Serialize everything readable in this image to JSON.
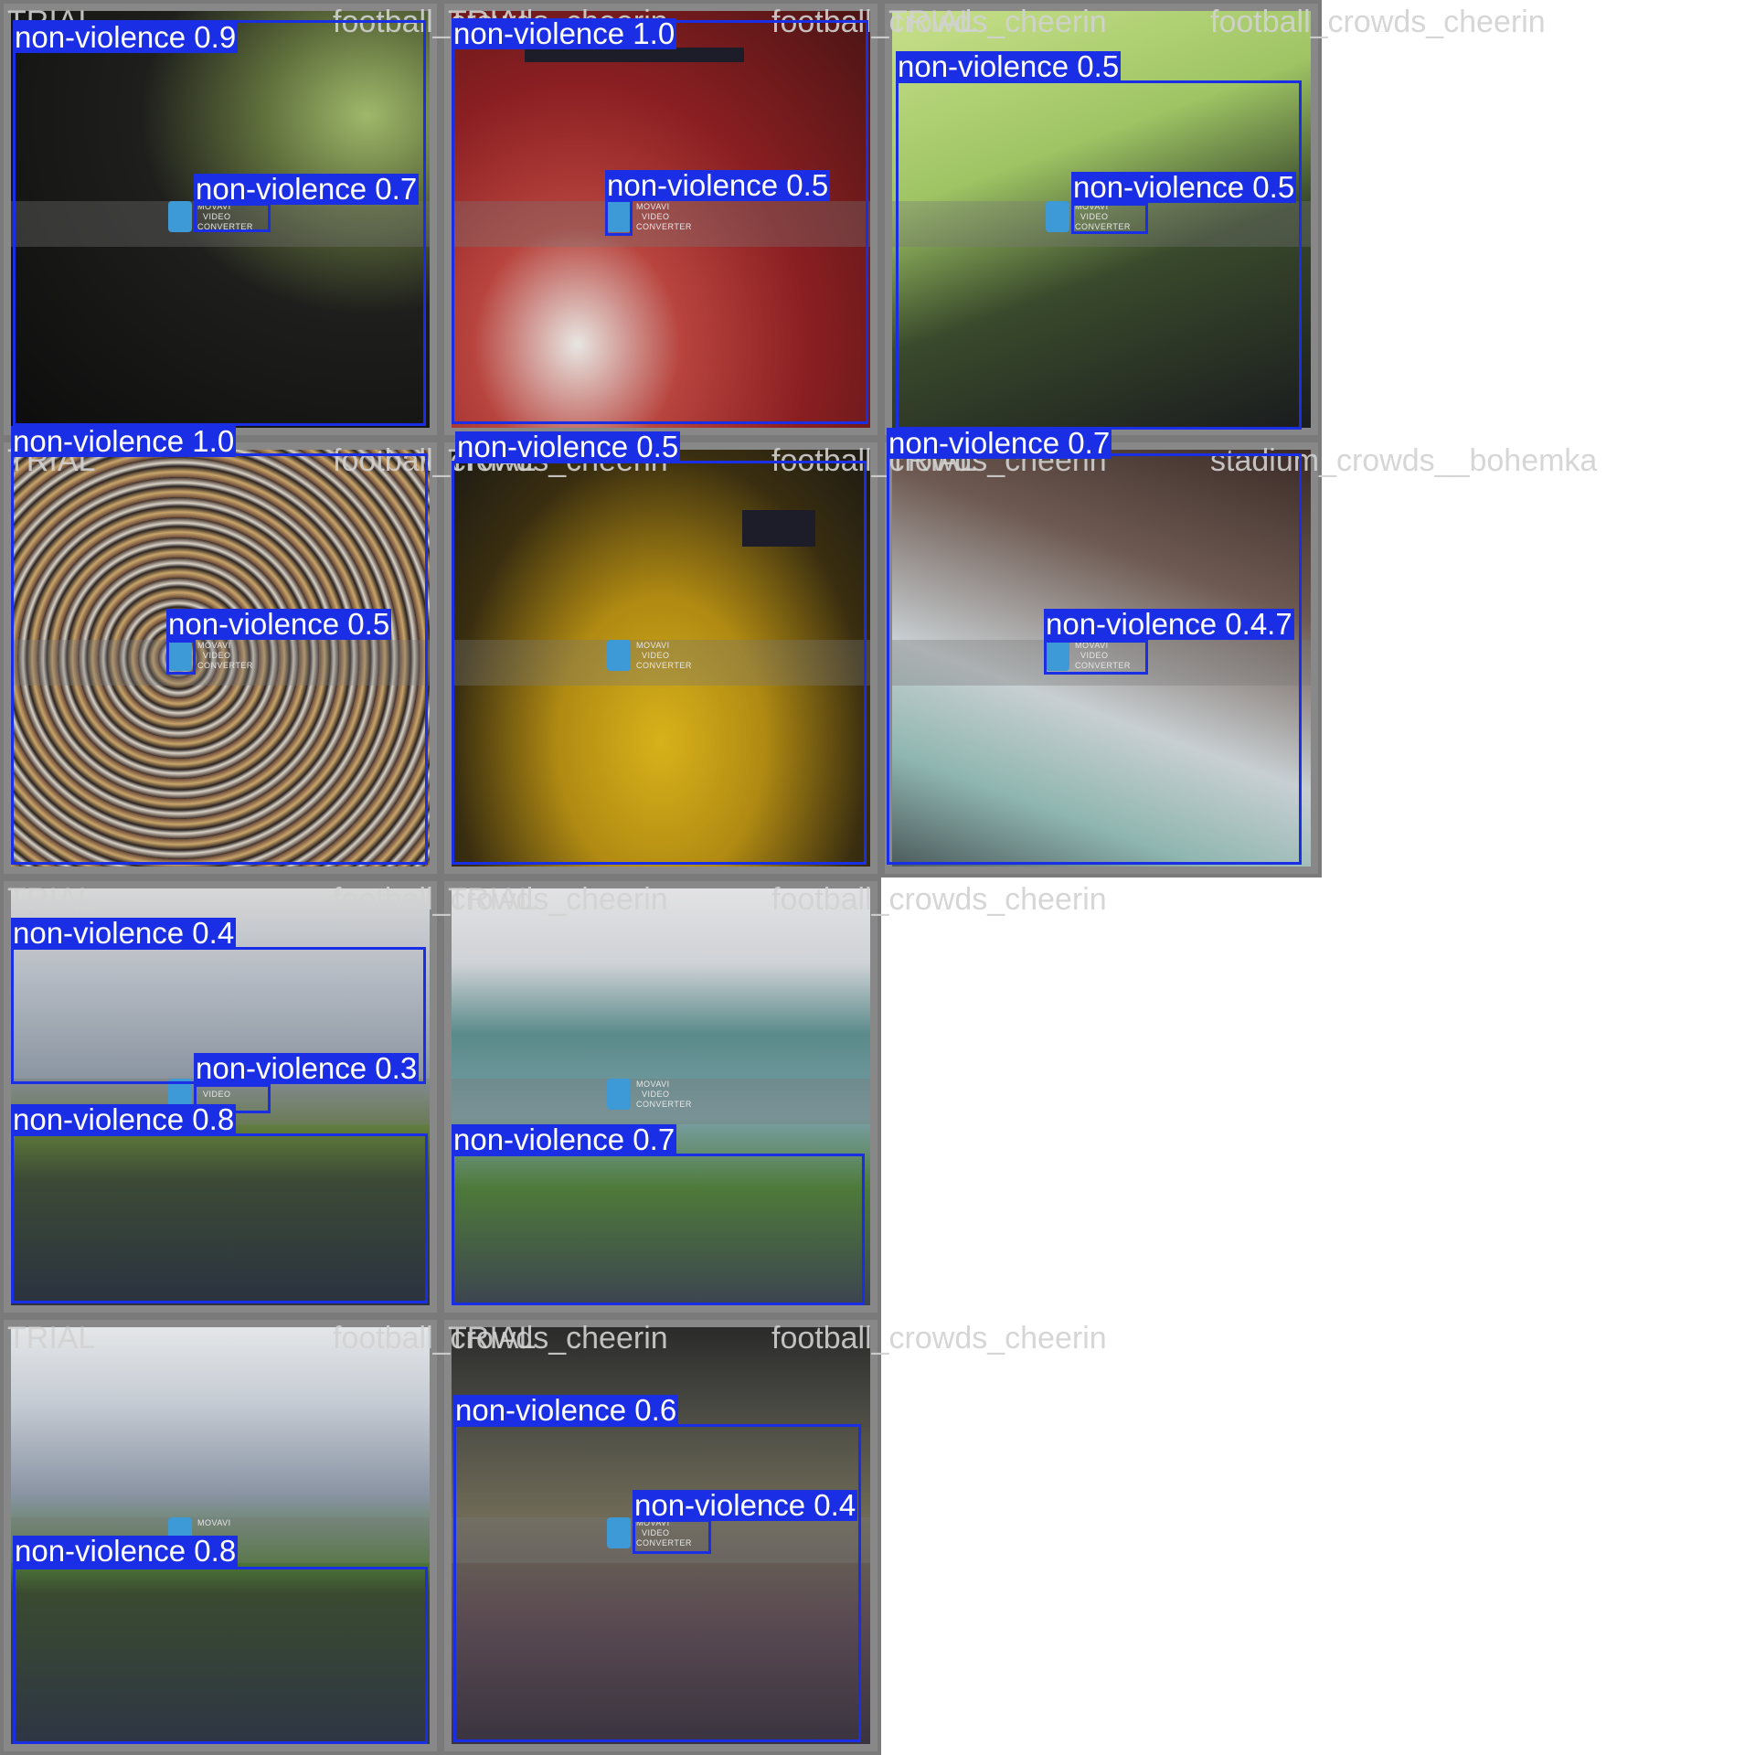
{
  "overlay": {
    "trial": "TRIAL",
    "football": "football_crowds_cheerin",
    "stadium": "stadium_crowds__bohemka"
  },
  "watermark": {
    "line1": "MOVAVI",
    "line2": "VIDEO",
    "line3": "CONVERTER"
  },
  "detection_class": "non-violence",
  "tiles": [
    {
      "scene": "dark blurred crowd at night",
      "detections": [
        {
          "label": "non-violence 0.9"
        },
        {
          "label": "non-violence 0.7"
        }
      ]
    },
    {
      "scene": "baseball fans in red cheering",
      "detections": [
        {
          "label": "non-violence 1.0"
        },
        {
          "label": "non-violence 0.5"
        }
      ]
    },
    {
      "scene": "fans in front of green field",
      "detections": [
        {
          "label": "non-violence 0.5"
        },
        {
          "label": "non-violence 0.5"
        }
      ]
    },
    {
      "scene": "dense stadium crowd",
      "detections": [
        {
          "label": "non-violence 1.0"
        },
        {
          "label": "non-violence 0.5"
        }
      ]
    },
    {
      "scene": "yellow waving crowd",
      "detections": [
        {
          "label": "non-violence 0.5"
        }
      ]
    },
    {
      "scene": "tilted view of fans under roof",
      "detections": [
        {
          "label": "non-violence 0.7"
        },
        {
          "label": "non-violence 0.4.7"
        }
      ]
    },
    {
      "scene": "stadium stands and field",
      "detections": [
        {
          "label": "non-violence 0.4"
        },
        {
          "label": "non-violence 0.3"
        },
        {
          "label": "non-violence 0.8"
        }
      ]
    },
    {
      "scene": "wide stadium with teal seats",
      "detections": [
        {
          "label": "non-violence 0.7"
        }
      ]
    },
    {
      "scene": "stands with green field",
      "detections": [
        {
          "label": "non-violence 0.8"
        }
      ]
    },
    {
      "scene": "crowd rushing the field",
      "detections": [
        {
          "label": "non-violence 0.6"
        },
        {
          "label": "non-violence 0.4"
        }
      ]
    }
  ]
}
